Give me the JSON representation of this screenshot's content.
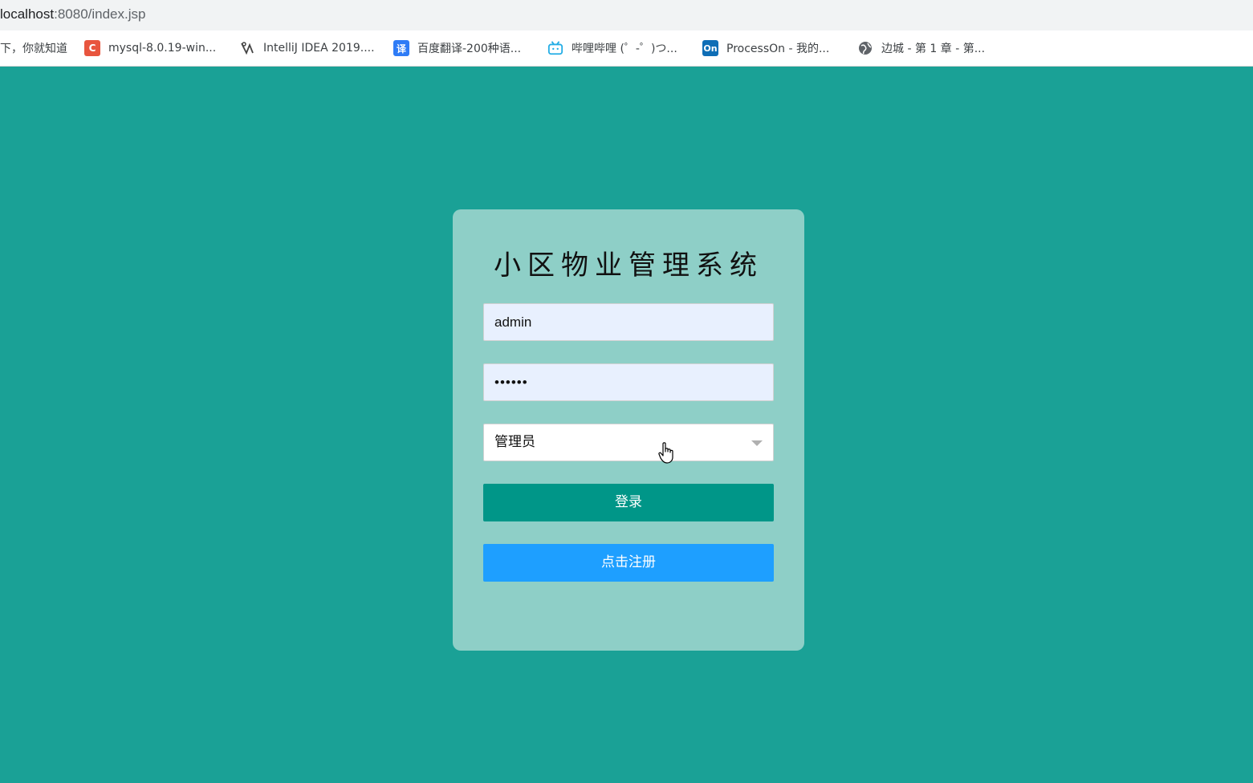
{
  "browser": {
    "url_host": "localhost",
    "url_path": ":8080/index.jsp",
    "bookmarks": [
      {
        "label": "下，你就知道",
        "icon": ""
      },
      {
        "label": "mysql-8.0.19-win...",
        "icon": "C"
      },
      {
        "label": "IntelliJ IDEA 2019....",
        "icon": "intellij-icon"
      },
      {
        "label": "百度翻译-200种语...",
        "icon": "译"
      },
      {
        "label": "哔哩哔哩 (゜-゜)つ...",
        "icon": "bilibili-icon"
      },
      {
        "label": "ProcessOn - 我的...",
        "icon": "On"
      },
      {
        "label": "边城 - 第 1 章 - 第...",
        "icon": "globe-icon"
      }
    ]
  },
  "login": {
    "title": "小区物业管理系统",
    "username_value": "admin",
    "password_value": "••••••",
    "role_selected": "管理员",
    "login_label": "登录",
    "register_label": "点击注册"
  },
  "colors": {
    "page_bg": "#1aa196",
    "card_bg": "#8ecfc7",
    "login_button": "#009688",
    "register_button": "#1e9fff",
    "autofill_bg": "#e8f0fe"
  }
}
